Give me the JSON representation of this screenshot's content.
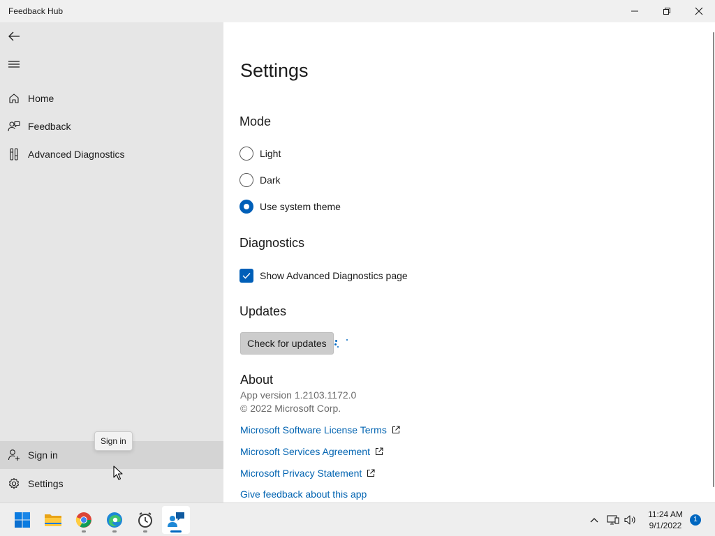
{
  "window": {
    "title": "Feedback Hub",
    "controls": {
      "minimize": "minimize-icon",
      "maximize": "restore-icon",
      "close": "close-icon"
    }
  },
  "sidebar": {
    "back_icon": "back-arrow-icon",
    "menu_icon": "hamburger-menu-icon",
    "items": [
      {
        "label": "Home",
        "icon": "home-icon"
      },
      {
        "label": "Feedback",
        "icon": "feedback-icon"
      },
      {
        "label": "Advanced Diagnostics",
        "icon": "diagnostics-icon"
      }
    ],
    "bottom_items": [
      {
        "label": "Sign in",
        "icon": "person-add-icon"
      },
      {
        "label": "Settings",
        "icon": "gear-icon"
      }
    ],
    "tooltip": "Sign in"
  },
  "settings": {
    "title": "Settings",
    "mode": {
      "heading": "Mode",
      "options": [
        {
          "label": "Light",
          "selected": false
        },
        {
          "label": "Dark",
          "selected": false
        },
        {
          "label": "Use system theme",
          "selected": true
        }
      ]
    },
    "diagnostics": {
      "heading": "Diagnostics",
      "checkbox_label": "Show Advanced Diagnostics page",
      "checked": true
    },
    "updates": {
      "heading": "Updates",
      "button_label": "Check for updates",
      "loading": true
    },
    "about": {
      "heading": "About",
      "version": "App version 1.2103.1172.0",
      "copyright": "© 2022 Microsoft Corp.",
      "links": [
        {
          "label": "Microsoft Software License Terms",
          "external": true
        },
        {
          "label": "Microsoft Services Agreement",
          "external": true
        },
        {
          "label": "Microsoft Privacy Statement",
          "external": true
        },
        {
          "label": "Give feedback about this app",
          "external": false
        }
      ]
    }
  },
  "taskbar": {
    "apps": [
      {
        "name": "start",
        "icon": "windows-start-icon"
      },
      {
        "name": "file-explorer",
        "icon": "folder-icon"
      },
      {
        "name": "chrome",
        "icon": "chrome-icon"
      },
      {
        "name": "edge",
        "icon": "edge-icon"
      },
      {
        "name": "alarms-clock",
        "icon": "clock-icon"
      },
      {
        "name": "feedback-hub",
        "icon": "feedback-hub-icon",
        "active": true
      }
    ],
    "tray": {
      "chevron": "chevron-up-icon",
      "network": "network-icon",
      "volume": "volume-icon"
    },
    "time": "11:24 AM",
    "date": "9/1/2022",
    "notification_count": "1"
  },
  "colors": {
    "accent": "#005fb8",
    "link": "#0063b1",
    "sidebar_bg": "#e6e6e6",
    "titlebar_bg": "#f0f0f0"
  }
}
